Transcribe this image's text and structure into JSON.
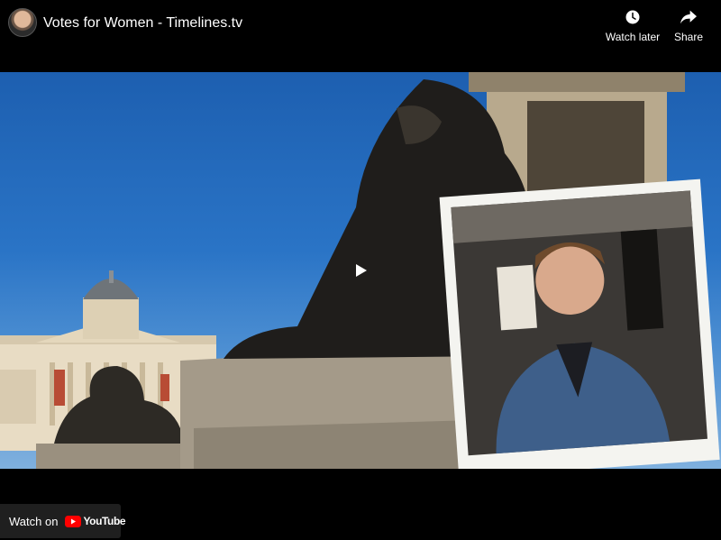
{
  "header": {
    "title": "Votes for Women - Timelines.tv",
    "actions": [
      {
        "label": "Watch later",
        "icon": "clock-icon"
      },
      {
        "label": "Share",
        "icon": "share-arrow-icon"
      }
    ]
  },
  "player": {
    "center_icon": "play-icon"
  },
  "footer": {
    "watch_on_label": "Watch on",
    "brand": "YouTube",
    "brand_icon": "youtube-logo-icon"
  },
  "colors": {
    "background": "#000000",
    "youtube_red": "#ff0000",
    "sky": "#2a74c6"
  }
}
